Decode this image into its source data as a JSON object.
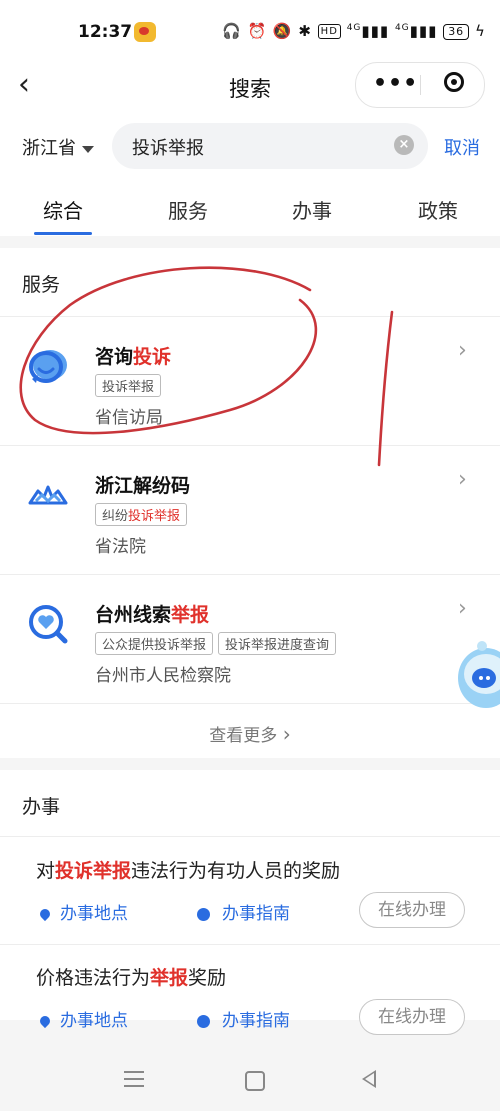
{
  "status_bar": {
    "time": "12:37",
    "icons_text": "🎧 ⏰ 🔕 ✱ ",
    "hd": "HD",
    "sig1": "4G",
    "sig2": "4G",
    "battery": "36"
  },
  "nav": {
    "title": "搜索"
  },
  "search": {
    "province": "浙江省",
    "query": "投诉举报",
    "cancel": "取消"
  },
  "tabs": [
    "综合",
    "服务",
    "办事",
    "政策"
  ],
  "services_section": {
    "title": "服务",
    "items": [
      {
        "name_plain": "咨询",
        "name_hl": "投诉",
        "tags": [
          {
            "pre": "投诉举报",
            "hl": ""
          }
        ],
        "org": "省信访局"
      },
      {
        "name_plain": "浙江解纷码",
        "name_hl": "",
        "tags": [
          {
            "pre": "纠纷",
            "hl": "投诉举报"
          }
        ],
        "org": "省法院"
      },
      {
        "name_plain": "台州线索",
        "name_hl": "举报",
        "tags": [
          {
            "pre": "公众提供投诉举报",
            "hl": ""
          },
          {
            "pre": "投诉举报进度查询",
            "hl": ""
          }
        ],
        "org": "台州市人民检察院"
      }
    ],
    "more": "查看更多"
  },
  "tasks_section": {
    "title": "办事",
    "items": [
      {
        "pre": "对",
        "hl": "投诉举报",
        "post": "违法行为有功人员的奖励",
        "location": "办事地点",
        "guide": "办事指南",
        "online": "在线办理"
      },
      {
        "pre": "价格违法行为",
        "hl": "举报",
        "post": "奖励",
        "location": "办事地点",
        "guide": "办事指南",
        "online": "在线办理"
      }
    ]
  },
  "colors": {
    "accent": "#2a6ce0",
    "highlight": "#e0312b",
    "annotation": "#c8353a"
  }
}
